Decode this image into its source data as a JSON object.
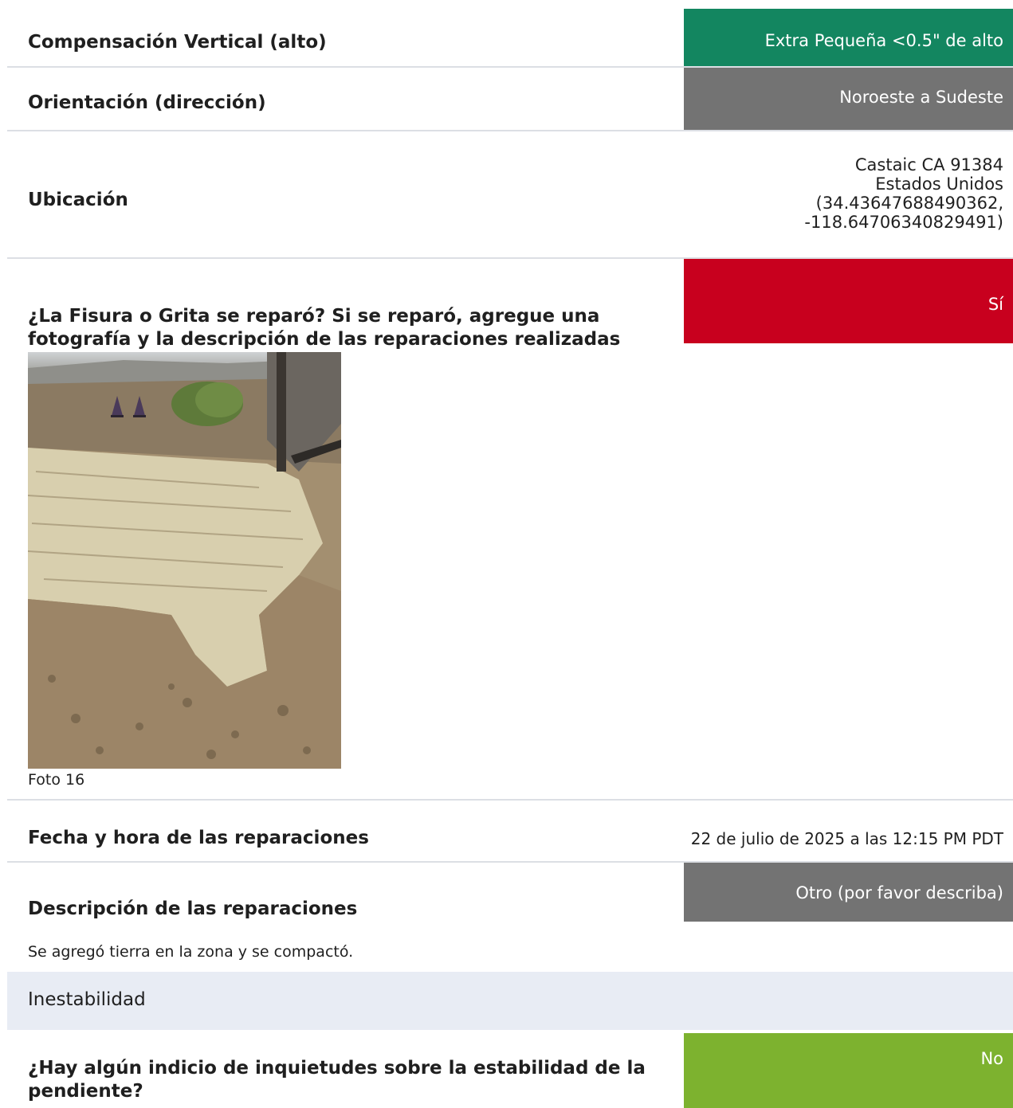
{
  "rows": {
    "vertical_offset": {
      "label": "Compensación Vertical (alto)",
      "value": "Extra Pequeña <0.5\" de alto",
      "color": "#138660"
    },
    "orientation": {
      "label": "Orientación (dirección)",
      "value": "Noroeste a Sudeste",
      "color": "#737373"
    },
    "location": {
      "label": "Ubicación",
      "lines": [
        "Castaic CA 91384",
        "Estados Unidos",
        "(34.43647688490362,",
        "-118.64706340829491)"
      ]
    },
    "repaired": {
      "label_line1": "¿La Fisura o Grita se reparó? Si se reparó, agregue una",
      "label_line2": "fotografía y la descripción de las reparaciones realizadas",
      "value": "Sí",
      "color": "#c8001e"
    },
    "photo_caption": "Foto 16",
    "repair_datetime": {
      "label": "Fecha y hora de las reparaciones",
      "value": "22 de julio de 2025 a las 12:15 PM PDT"
    },
    "repair_description": {
      "label": "Descripción de las reparaciones",
      "value": "Otro (por favor describa)",
      "color": "#737373"
    },
    "repair_note": "Se agregó tierra en la zona y se compactó.",
    "section_title": "Inestabilidad",
    "stability": {
      "label_line1": "¿Hay algún indicio de inquietudes sobre la estabilidad de la",
      "label_line2": "pendiente?",
      "value": "No",
      "color": "#7db22f"
    }
  }
}
